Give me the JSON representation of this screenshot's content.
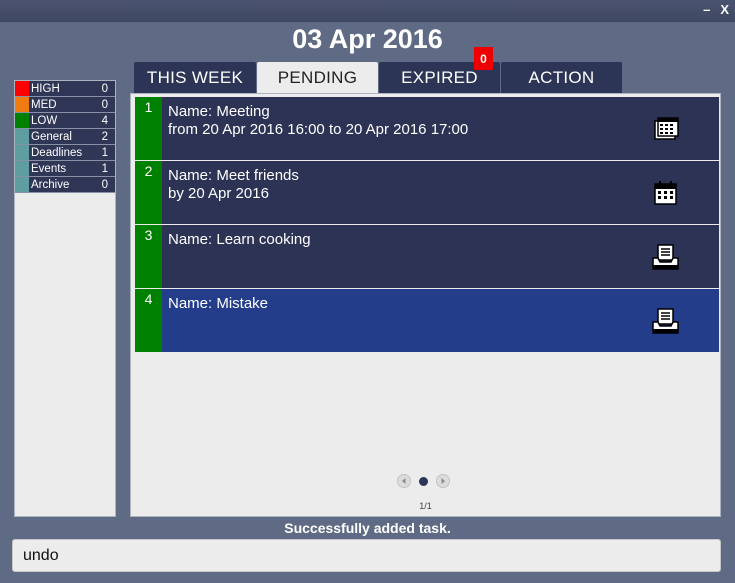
{
  "window": {
    "minimize_label": "–",
    "close_label": "X"
  },
  "header": {
    "date": "03 Apr 2016"
  },
  "categories": [
    {
      "label": "HIGH",
      "count": "0",
      "color": "#ff0000"
    },
    {
      "label": "MED",
      "count": "0",
      "color": "#ee7a10"
    },
    {
      "label": "LOW",
      "count": "4",
      "color": "#008000"
    },
    {
      "label": "General",
      "count": "2",
      "color": "#5f9ea0"
    },
    {
      "label": "Deadlines",
      "count": "1",
      "color": "#5f9ea0"
    },
    {
      "label": "Events",
      "count": "1",
      "color": "#5f9ea0"
    },
    {
      "label": "Archive",
      "count": "0",
      "color": "#5f9ea0"
    }
  ],
  "tabs": [
    {
      "label": "THIS WEEK"
    },
    {
      "label": "PENDING",
      "active": true
    },
    {
      "label": "EXPIRED",
      "badge": "0"
    },
    {
      "label": "ACTION"
    }
  ],
  "tasks": [
    {
      "number": "1",
      "line1": "Name: Meeting",
      "line2": "from 20 Apr 2016 16:00 to 20 Apr 2016 17:00",
      "icon": "calendar-range-icon"
    },
    {
      "number": "2",
      "line1": "Name: Meet friends",
      "line2": "by 20 Apr 2016",
      "icon": "calendar-icon"
    },
    {
      "number": "3",
      "line1": "Name: Learn cooking",
      "line2": "",
      "icon": "inbox-document-icon"
    },
    {
      "number": "4",
      "line1": "Name: Mistake",
      "line2": "",
      "icon": "inbox-document-icon",
      "selected": true
    }
  ],
  "pagination": {
    "indicator": "1/1"
  },
  "status": {
    "message": "Successfully added task."
  },
  "command": {
    "value": "undo"
  },
  "colors": {
    "background": "#5f6a84",
    "panel": "#ececec",
    "task_bg": "#2c3354",
    "task_selected_bg": "#233d8a",
    "priority_low": "#008000",
    "badge": "#ee0000"
  }
}
